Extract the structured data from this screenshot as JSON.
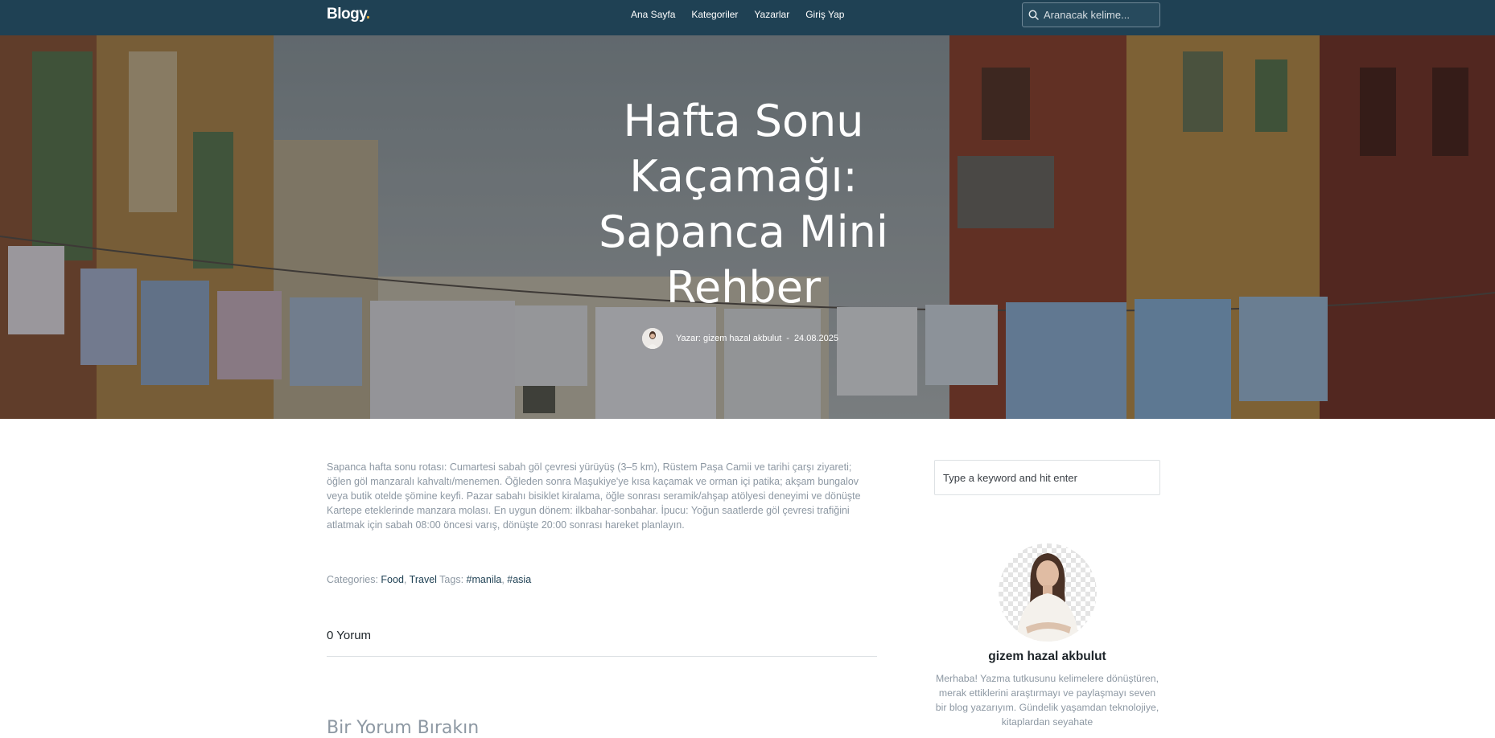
{
  "nav": {
    "brand": "Blogy",
    "brand_dot": ".",
    "links": [
      "Ana Sayfa",
      "Kategoriler",
      "Yazarlar",
      "Giriş Yap"
    ],
    "search_placeholder": "Aranacak kelime..."
  },
  "hero": {
    "title": "Hafta Sonu Kaçamağı: Sapanca Mini Rehber",
    "author_line": "Yazar: gizem hazal akbulut",
    "separator": "-",
    "date": "24.08.2025"
  },
  "article": {
    "body": "Sapanca hafta sonu rotası: Cumartesi sabah göl çevresi yürüyüş (3–5 km), Rüstem Paşa Camii ve tarihi çarşı ziyareti; öğlen göl manzaralı kahvaltı/menemen. Öğleden sonra Maşukiye'ye kısa kaçamak ve orman içi patika; akşam bungalov veya butik otelde şömine keyfi. Pazar sabahı bisiklet kiralama, öğle sonrası seramik/ahşap atölyesi deneyimi ve dönüşte Kartepe eteklerinde manzara molası. En uygun dönem: ilkbahar-sonbahar. İpucu: Yoğun saatlerde göl çevresi trafiğini atlatmak için sabah 08:00 öncesi varış, dönüşte 20:00 sonrası hareket planlayın.",
    "categories_label": "Categories:",
    "categories": [
      "Food",
      "Travel"
    ],
    "tags_label": "Tags:",
    "tags": [
      "#manila",
      "#asia"
    ],
    "comments_count": "0 Yorum",
    "leave_comment_heading": "Bir Yorum Bırakın"
  },
  "sidebar": {
    "search_placeholder": "Type a keyword and hit enter",
    "author_name": "gizem hazal akbulut",
    "author_bio": "Merhaba! Yazma tutkusunu kelimelere dönüştüren, merak ettiklerini araştırmayı ve paylaşmayı seven bir blog yazarıyım. Gündelik yaşamdan teknolojiye, kitaplardan seyahate"
  },
  "colors": {
    "navbar": "#1f4154",
    "link": "#1f4154",
    "muted_text": "#8d98a3",
    "brand_dot": "#f2b134"
  },
  "icons": {
    "search": "search-icon",
    "author_avatar": "avatar",
    "hero_background": "street-laundry-photo"
  }
}
